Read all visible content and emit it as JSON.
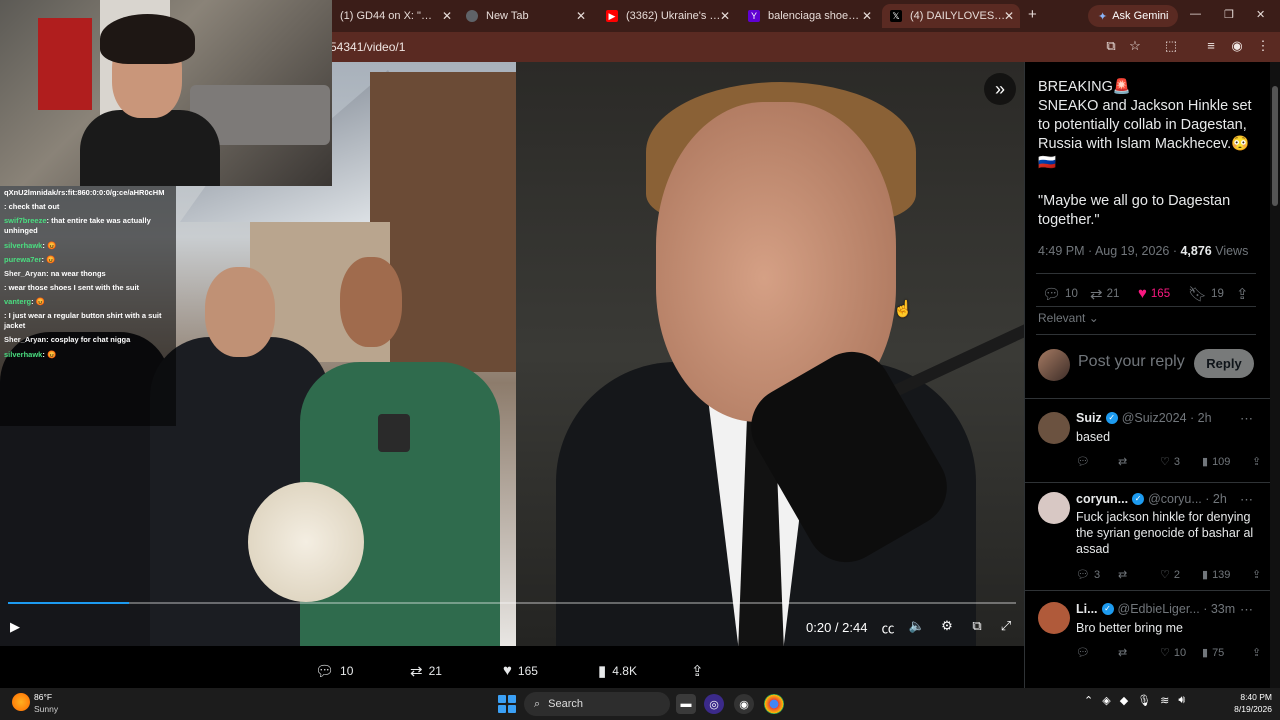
{
  "browser": {
    "tabs": [
      {
        "label": "(1) GD44 on X: \"https:/",
        "icon": "x-icon",
        "color": "#000000"
      },
      {
        "label": "New Tab",
        "icon": "globe-icon",
        "color": "#5f6368"
      },
      {
        "label": "(3362) Ukraine's \"Singl",
        "icon": "youtube-icon",
        "color": "#ff0000"
      },
      {
        "label": "balenciaga shoes - Yah",
        "icon": "yahoo-icon",
        "color": "#6001d2"
      },
      {
        "label": "(4) DAILYLOVESPEECH",
        "icon": "x-icon",
        "color": "#000000"
      }
    ],
    "new_tab_symbol": "+",
    "gemini_button": "Ask Gemini",
    "window_controls": [
      "—",
      "❐",
      "✕"
    ],
    "url": "54341/video/1"
  },
  "stream_chat": [
    {
      "user": "",
      "text": "qXnU2lmnidak/rs:fit:860:0:0:0/g:ce/aHR0cHM",
      "user_color": "#ffffff"
    },
    {
      "user": "",
      "text": ": check that out",
      "user_color": "#60a5fa"
    },
    {
      "user": "swif7breeze",
      "text": ": that entire take was actually unhinged",
      "user_color": "#4ade80"
    },
    {
      "user": "silverhawk",
      "text": ": 😡",
      "user_color": "#4ade80"
    },
    {
      "user": "purewa7er",
      "text": ": 😡",
      "user_color": "#4ade80"
    },
    {
      "user": "Sher_Aryan",
      "text": ": na wear thongs",
      "user_color": "#f5f5f5"
    },
    {
      "user": "",
      "text": ": wear those shoes I sent with the suit",
      "user_color": "#60a5fa"
    },
    {
      "user": "vanterg",
      "text": ": 😡",
      "user_color": "#4ade80"
    },
    {
      "user": "",
      "text": ": I just wear a regular button shirt with a suit jacket",
      "user_color": "#f97316"
    },
    {
      "user": "Sher_Aryan",
      "text": ": cosplay for chat nigga",
      "user_color": "#f5f5f5"
    },
    {
      "user": "silverhawk",
      "text": ": 😡",
      "user_color": "#4ade80"
    }
  ],
  "video": {
    "progress": 0.12,
    "time": "0:20 / 2:44",
    "expand_icon": "double-chevron-right-icon"
  },
  "actions": {
    "replies": "10",
    "reposts": "21",
    "likes": "165",
    "views": "4.8K"
  },
  "tweet": {
    "text": "BREAKING🚨\nSNEAKO and Jackson Hinkle set to potentially collab in Dagestan, Russia with Islam Mackhecev.😳 🇷🇺",
    "quote": "\"Maybe we all go to Dagestan together.\"",
    "time": "4:49 PM · Aug 19, 2026 · ",
    "views_count": "4,876",
    "views_label": " Views",
    "stats": {
      "replies": "10",
      "reposts": "21",
      "likes": "165",
      "bookmarks": "19"
    },
    "sort": "Relevant",
    "reply_placeholder": "Post your reply",
    "reply_button": "Reply"
  },
  "replies": [
    {
      "name": "Suiz",
      "handle": "@Suiz2024 · 2h",
      "text": "based",
      "replies": "",
      "reposts": "",
      "likes": "3",
      "views": "109",
      "avatar_color": "#6b5240"
    },
    {
      "name": "coryun...",
      "handle": "@coryu... · 2h",
      "text": "Fuck jackson hinkle for denying the syrian genocide of bashar al assad",
      "replies": "3",
      "reposts": "",
      "likes": "2",
      "views": "139",
      "avatar_color": "#d8c8c4"
    },
    {
      "name": "Li...",
      "handle": "@EdbieLiger... · 33m",
      "text": "Bro better bring me",
      "replies": "",
      "reposts": "",
      "likes": "10",
      "views": "75",
      "avatar_color": "#b05a3a"
    }
  ],
  "taskbar": {
    "temp": "86°F",
    "condition": "Sunny",
    "search": "Search",
    "time": "8:40 PM",
    "date": "8/19/2026"
  }
}
